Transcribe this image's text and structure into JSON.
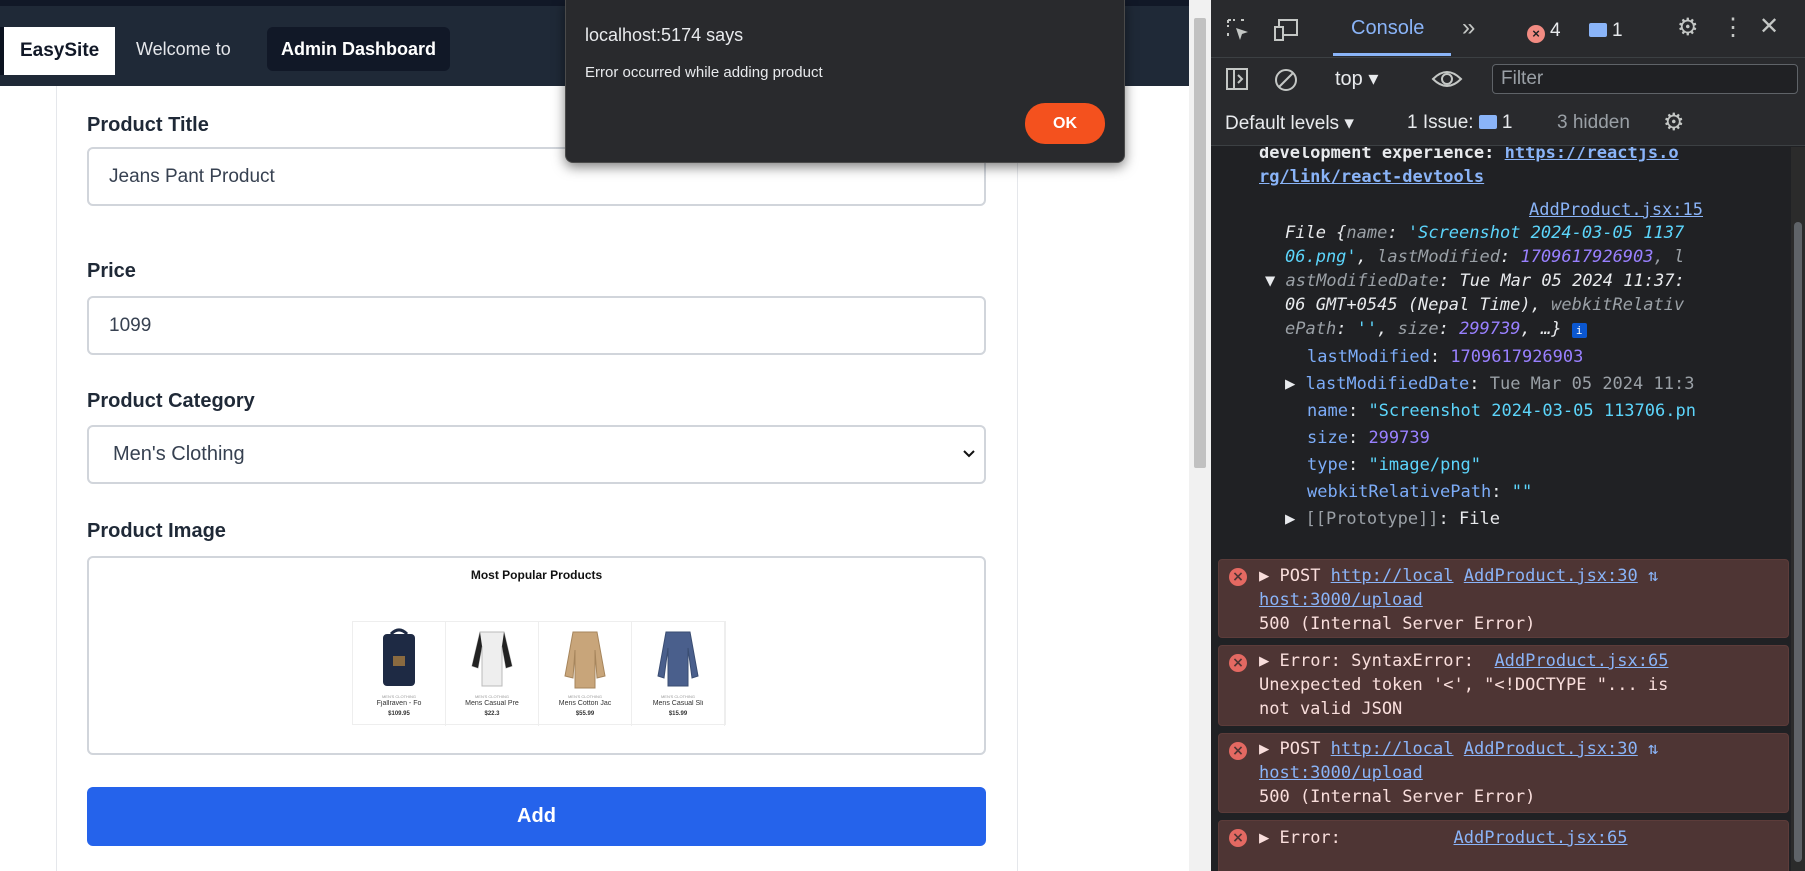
{
  "navbar": {
    "brand": "EasySite",
    "welcome": "Welcome to",
    "admin": "Admin Dashboard"
  },
  "form": {
    "title_label": "Product Title",
    "title_value": "Jeans Pant Product",
    "price_label": "Price",
    "price_value": "1099",
    "category_label": "Product Category",
    "category_value": "Men's Clothing",
    "image_label": "Product Image",
    "add_button": "Add"
  },
  "image_preview": {
    "title": "Most Popular Products",
    "products": [
      {
        "category": "MEN'S CLOTHING",
        "name": "Fjallraven - Fo",
        "price": "$109.95"
      },
      {
        "category": "MEN'S CLOTHING",
        "name": "Mens Casual Pre",
        "price": "$22.3"
      },
      {
        "category": "MEN'S CLOTHING",
        "name": "Mens Cotton Jac",
        "price": "$55.99"
      },
      {
        "category": "MEN'S CLOTHING",
        "name": "Mens Casual Sli",
        "price": "$15.99"
      }
    ]
  },
  "dialog": {
    "title": "localhost:5174 says",
    "message": "Error occurred while adding product",
    "ok": "OK"
  },
  "devtools": {
    "tab_console": "Console",
    "error_count": "4",
    "message_count": "1",
    "context": "top",
    "filter_placeholder": "Filter",
    "levels": "Default levels",
    "issues": "1 Issue:",
    "issues_count": "1",
    "hidden": "3 hidden",
    "colors": {
      "error_bg": "#4e3534",
      "link": "#8ab4f8",
      "string": "#5cd5fb",
      "number": "#9980ff"
    }
  },
  "console": {
    "line1a": "development experience: ",
    "line1b": "https://reactjs.o",
    "line2": "rg/link/react-devtools",
    "src15": "AddProduct.jsx:15",
    "file_open": "File {",
    "k_name": "name",
    "v_name": "'Screenshot 2024-03-05 1137",
    "v_name2": "06.png'",
    "k_lastmod": "lastModified",
    "v_lastmod": "1709617926903",
    "tail_l": ", l",
    "k_lastmoddate": "astModifiedDate",
    "v_lastmoddate": "Tue Mar 05 2024 11:37:",
    "v_lastmoddate2": "06 GMT+0545 (Nepal Time)",
    "k_webkit_part": "webkitRelativ",
    "k_epath": "ePath",
    "v_epath": "''",
    "k_size": "size",
    "v_size": "299739",
    "ellipsis": ", …}",
    "prop_lastmod": "lastModified",
    "prop_lastmod_v": "1709617926903",
    "prop_lastmoddate": "lastModifiedDate",
    "prop_lastmoddate_v": "Tue Mar 05 2024 11:3",
    "prop_name": "name",
    "prop_name_v": "\"Screenshot 2024-03-05 113706.pn",
    "prop_size": "size",
    "prop_size_v": "299739",
    "prop_type": "type",
    "prop_type_v": "\"image/png\"",
    "prop_webkit": "webkitRelativePath",
    "prop_webkit_v": "\"\"",
    "prototype": "[[Prototype]]",
    "prototype_v": "File",
    "err1_method": "POST ",
    "err1_url_a": "http://local",
    "err1_src": "AddProduct.jsx:30",
    "err1_url_b": "host:3000/upload",
    "err1_status": "500 (Internal Server Error)",
    "err2_head": "Error: SyntaxError:",
    "err2_src": "AddProduct.jsx:65",
    "err2_line2": "Unexpected token '<', \"<!DOCTYPE \"... is",
    "err2_line3": "not valid JSON",
    "err3_method": "POST ",
    "err3_url_a": "http://local",
    "err3_src": "AddProduct.jsx:30",
    "err3_url_b": "host:3000/upload",
    "err3_status": "500 (Internal Server Error)",
    "err4_head": "Error:",
    "err4_src": "AddProduct.jsx:65"
  }
}
